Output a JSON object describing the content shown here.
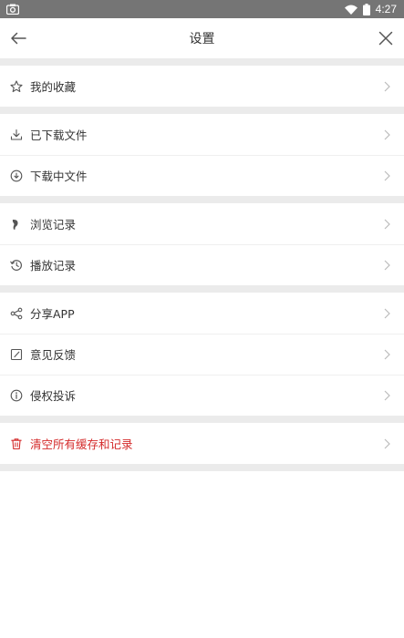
{
  "status_bar": {
    "time": "4:27"
  },
  "header": {
    "title": "设置"
  },
  "groups": [
    {
      "items": [
        {
          "label": "我的收藏",
          "icon": "star-icon"
        }
      ]
    },
    {
      "items": [
        {
          "label": "已下载文件",
          "icon": "download-tray-icon"
        },
        {
          "label": "下载中文件",
          "icon": "download-circle-icon"
        }
      ]
    },
    {
      "items": [
        {
          "label": "浏览记录",
          "icon": "footprint-icon"
        },
        {
          "label": "播放记录",
          "icon": "history-icon"
        }
      ]
    },
    {
      "items": [
        {
          "label": "分享APP",
          "icon": "share-icon"
        },
        {
          "label": "意见反馈",
          "icon": "edit-icon"
        },
        {
          "label": "侵权投诉",
          "icon": "info-icon"
        }
      ]
    },
    {
      "items": [
        {
          "label": "清空所有缓存和记录",
          "icon": "trash-icon"
        }
      ]
    }
  ],
  "colors": {
    "danger": "#d42a2a",
    "status_bar": "#757575",
    "divider": "#ebebeb"
  }
}
